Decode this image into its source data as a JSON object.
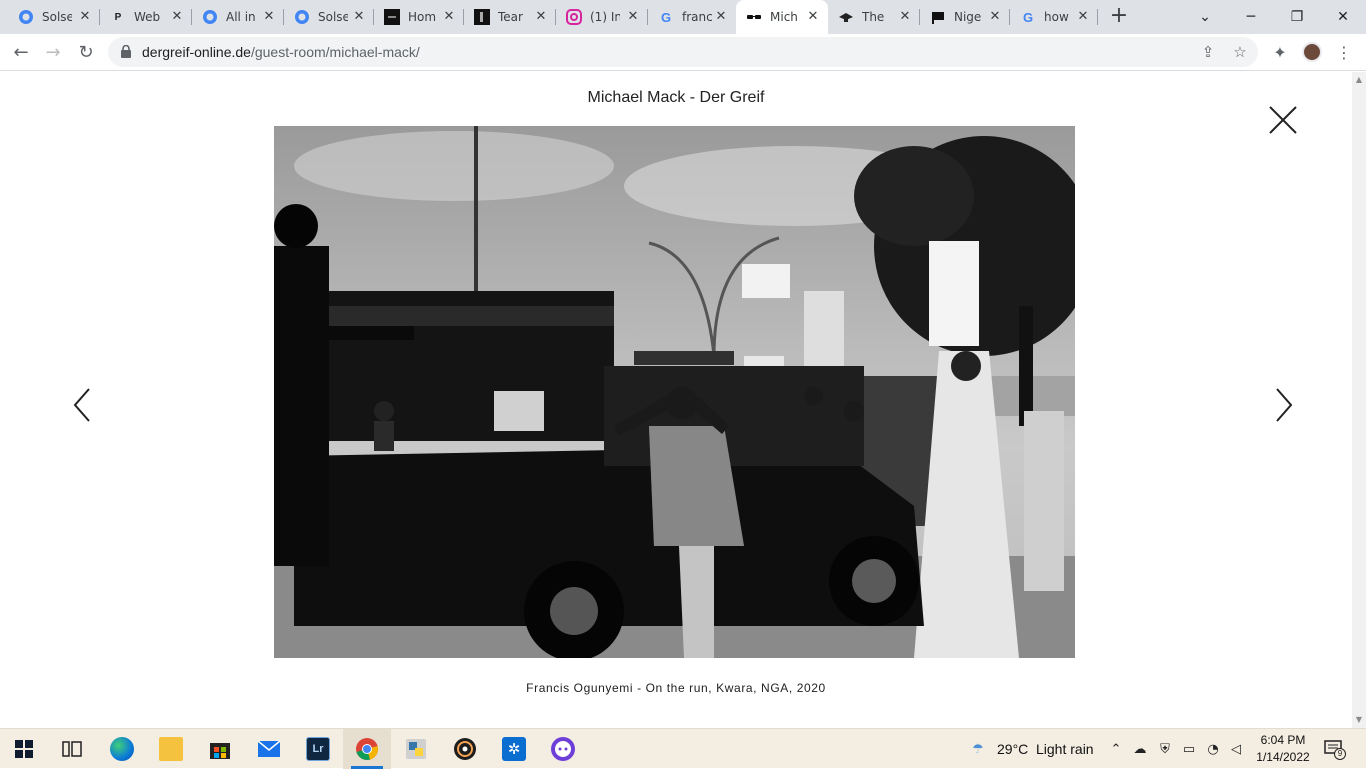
{
  "browser": {
    "tabs": [
      {
        "title": "Solse",
        "icon": "solsense-icon"
      },
      {
        "title": "Web",
        "icon": "p-letter-icon"
      },
      {
        "title": "All in",
        "icon": "solsense-icon"
      },
      {
        "title": "Solse",
        "icon": "solsense-icon"
      },
      {
        "title": "Hom",
        "icon": "site-dark-icon"
      },
      {
        "title": "Tear",
        "icon": "site-dark-icon"
      },
      {
        "title": "(1) In",
        "icon": "instagram-icon"
      },
      {
        "title": "franc",
        "icon": "google-icon"
      },
      {
        "title": "Mich",
        "icon": "glasses-icon",
        "active": true
      },
      {
        "title": "The",
        "icon": "hat-icon"
      },
      {
        "title": "Nige",
        "icon": "flag-icon"
      },
      {
        "title": "how",
        "icon": "google-icon"
      }
    ],
    "new_tab": "+",
    "url_domain": "dergreif-online.de",
    "url_path": "/guest-room/michael-mack/"
  },
  "page": {
    "title": "Michael Mack - Der Greif",
    "caption": "Francis Ogunyemi - On the run, Kwara, NGA, 2020",
    "close_icon": "close-icon",
    "prev_icon": "chevron-left-icon",
    "next_icon": "chevron-right-icon"
  },
  "taskbar": {
    "apps": [
      {
        "name": "task-view",
        "icon": "task-view-icon"
      },
      {
        "name": "edge",
        "icon": "edge-icon"
      },
      {
        "name": "file-explorer",
        "icon": "folder-icon"
      },
      {
        "name": "store",
        "icon": "store-icon"
      },
      {
        "name": "mail",
        "icon": "mail-icon"
      },
      {
        "name": "lightroom",
        "icon": "lightroom-icon",
        "label": "Lr"
      },
      {
        "name": "chrome",
        "icon": "chrome-icon",
        "active": true
      },
      {
        "name": "python",
        "icon": "python-icon"
      },
      {
        "name": "media",
        "icon": "media-icon"
      },
      {
        "name": "settings",
        "icon": "settings-icon"
      },
      {
        "name": "chat",
        "icon": "chat-icon"
      }
    ],
    "weather_temp": "29°C",
    "weather_desc": "Light rain",
    "time": "6:04 PM",
    "date": "1/14/2022",
    "notifications": "9"
  }
}
